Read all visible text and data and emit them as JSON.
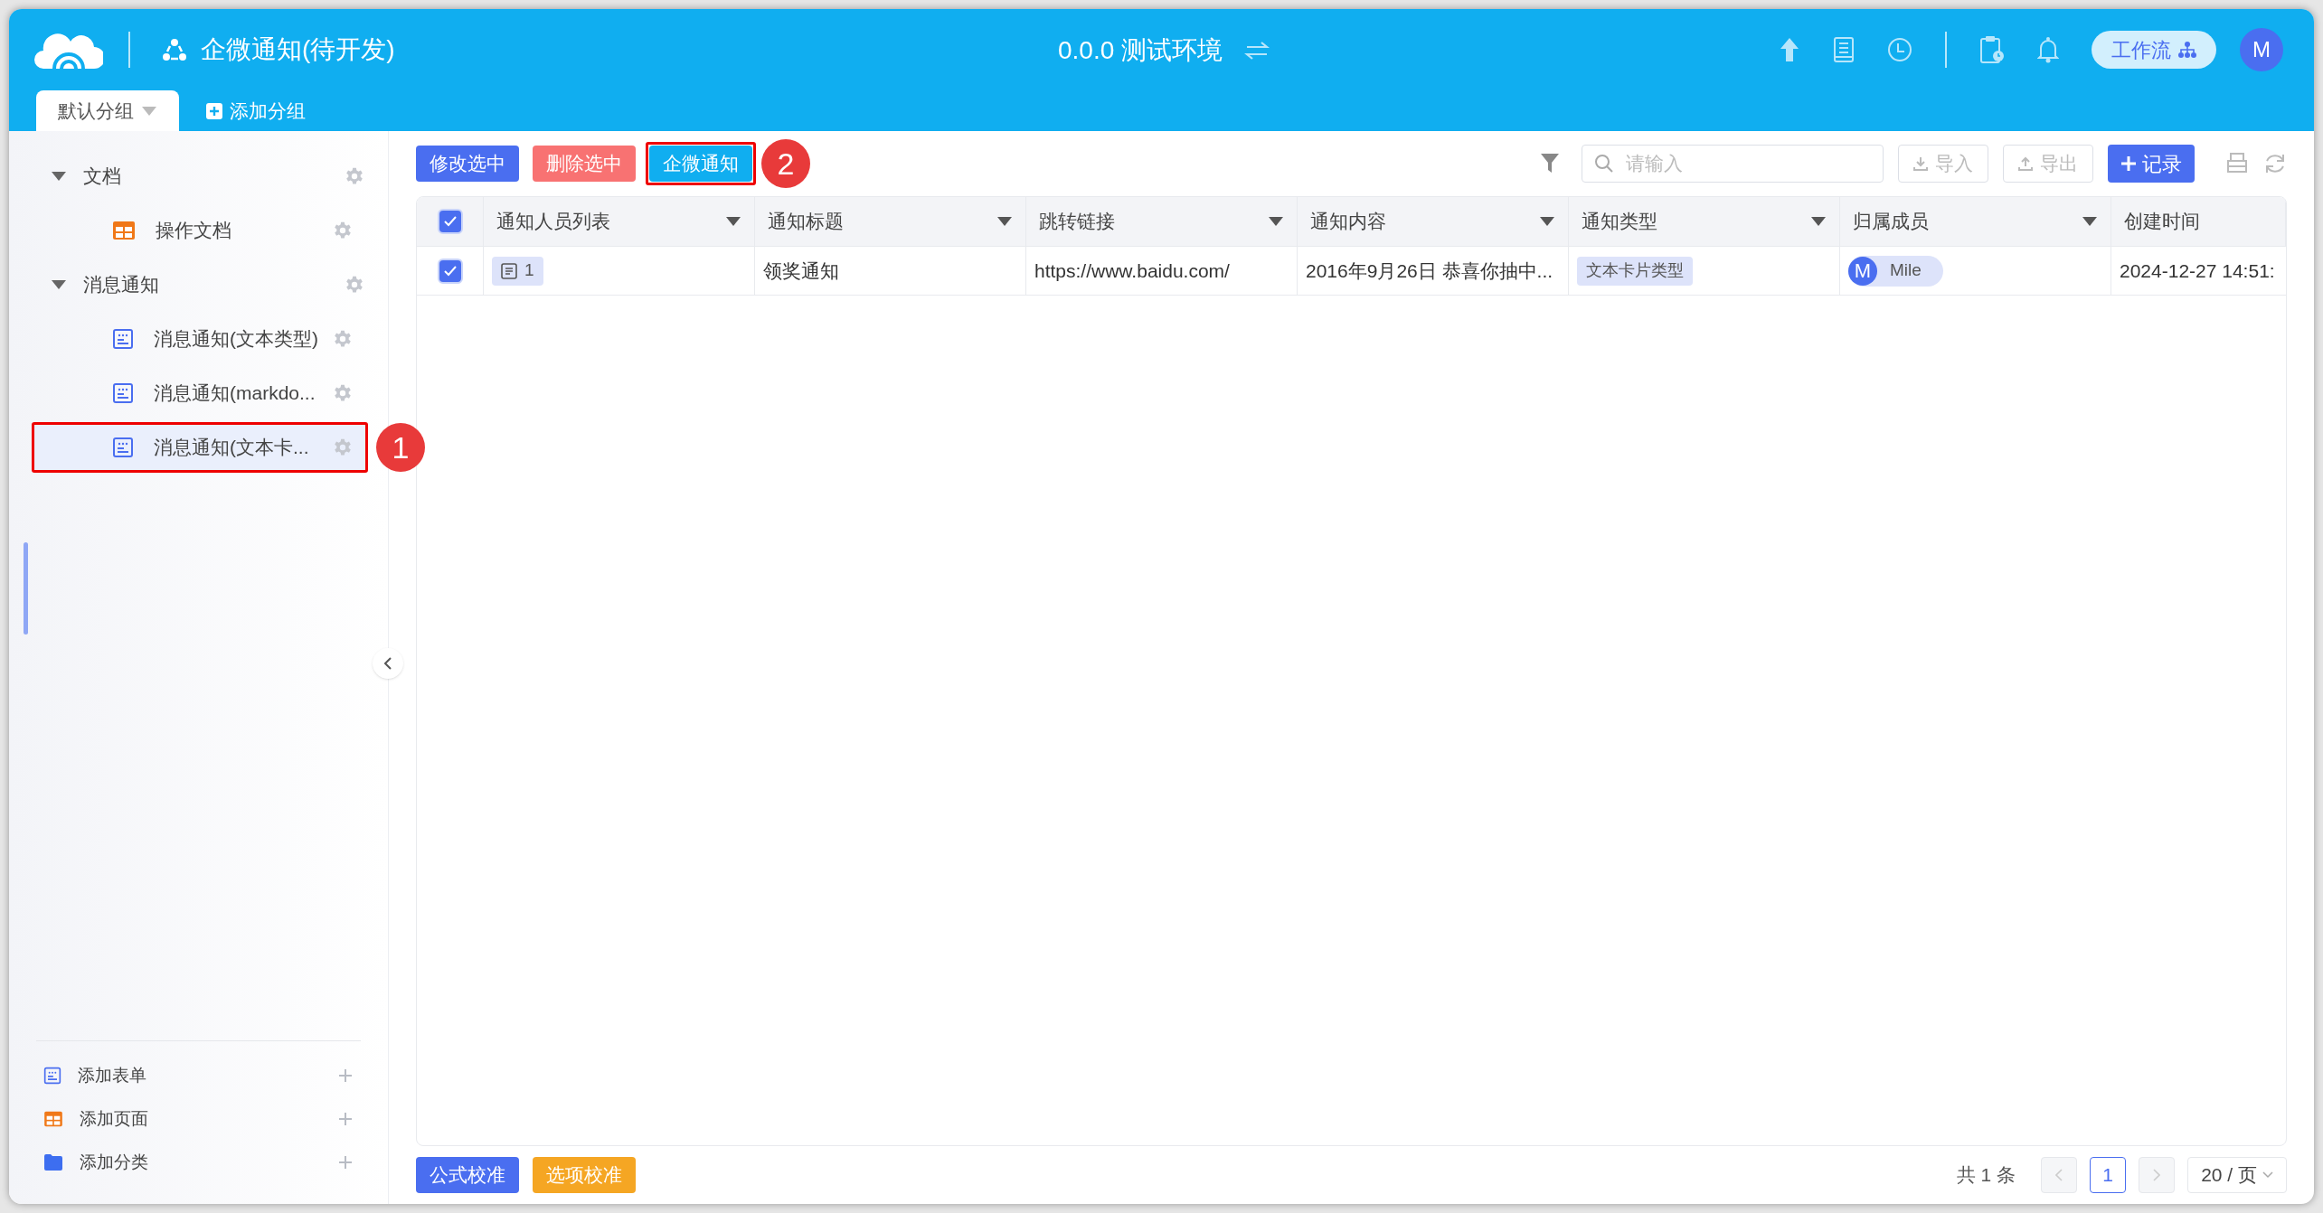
{
  "header": {
    "title": "企微通知(待开发)",
    "environment": "0.0.0 测试环境",
    "workflow_button": "工作流",
    "avatar": "M"
  },
  "group_tabs": [
    {
      "label": "默认分组",
      "selected": true
    }
  ],
  "add_group": "添加分组",
  "sidebar": {
    "tree": [
      {
        "label": "文档",
        "expanded": true,
        "children": [
          {
            "label": "操作文档",
            "kind": "page",
            "selected": false
          }
        ]
      },
      {
        "label": "消息通知",
        "expanded": true,
        "children": [
          {
            "label": "消息通知(文本类型)",
            "kind": "form",
            "selected": false
          },
          {
            "label": "消息通知(markdo...",
            "kind": "form",
            "selected": false
          },
          {
            "label": "消息通知(文本卡...",
            "kind": "form",
            "selected": true,
            "callout": "1"
          }
        ]
      }
    ],
    "add_items": [
      {
        "label": "添加表单",
        "kind": "form"
      },
      {
        "label": "添加页面",
        "kind": "page"
      },
      {
        "label": "添加分类",
        "kind": "folder"
      }
    ]
  },
  "toolbar": {
    "actions": [
      {
        "label": "修改选中",
        "kind": "primary"
      },
      {
        "label": "删除选中",
        "kind": "danger"
      },
      {
        "label": "企微通知",
        "kind": "info",
        "callout": "2"
      }
    ],
    "search": {
      "placeholder": "请输入"
    },
    "import": "导入",
    "export": "导出",
    "add_record": "记录"
  },
  "table": {
    "all_selected": true,
    "columns": [
      {
        "label": "通知人员列表",
        "menu": true
      },
      {
        "label": "通知标题",
        "menu": true
      },
      {
        "label": "跳转链接",
        "menu": true
      },
      {
        "label": "通知内容",
        "menu": true
      },
      {
        "label": "通知类型",
        "menu": true
      },
      {
        "label": "归属成员",
        "menu": true
      },
      {
        "label": "创建时间",
        "menu": false
      }
    ],
    "rows": [
      {
        "selected": true,
        "members": "1",
        "title": "领奖通知",
        "link": "https://www.baidu.com/",
        "content": "2016年9月26日 恭喜你抽中...",
        "type": "文本卡片类型",
        "owner": {
          "avatar": "M",
          "name": "Mile"
        },
        "created": "2024-12-27 14:51:"
      }
    ]
  },
  "footer": {
    "buttons": [
      {
        "label": "公式校准",
        "kind": "primary"
      },
      {
        "label": "选项校准",
        "kind": "warning"
      }
    ],
    "total": "共 1 条",
    "pages": [
      {
        "label": "1",
        "selected": true
      }
    ],
    "page_size": "20 / 页"
  }
}
